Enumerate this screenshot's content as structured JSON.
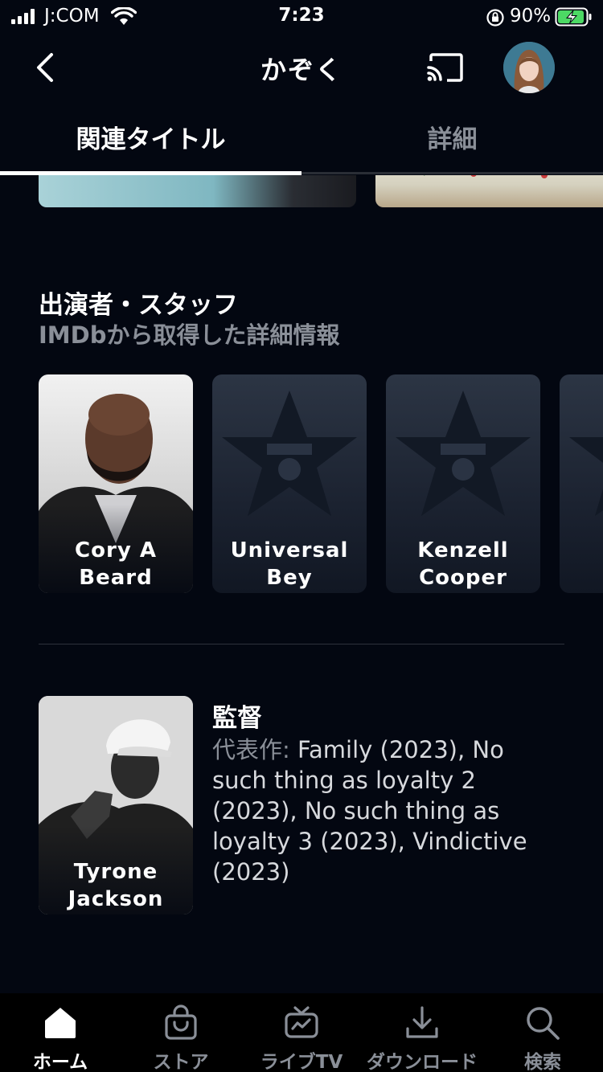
{
  "status_bar": {
    "carrier": "J:COM",
    "time": "7:23",
    "battery_percent": "90%"
  },
  "header": {
    "title": "かぞく"
  },
  "tabs": [
    {
      "label": "関連タイトル",
      "active": true
    },
    {
      "label": "詳細",
      "active": false
    }
  ],
  "cast_section": {
    "title": "出演者・スタッフ",
    "subtitle": "IMDbから取得した詳細情報",
    "members": [
      {
        "name_line1": "Cory A",
        "name_line2": "Beard",
        "has_photo": true
      },
      {
        "name_line1": "Universal",
        "name_line2": "Bey",
        "has_photo": false
      },
      {
        "name_line1": "Kenzell",
        "name_line2": "Cooper",
        "has_photo": false
      }
    ]
  },
  "director": {
    "name_line1": "Tyrone",
    "name_line2": "Jackson",
    "role": "監督",
    "works_label": "代表作: ",
    "works": "Family (2023), No such thing as loyalty 2 (2023), No such thing as loyalty 3 (2023), Vindictive (2023)"
  },
  "bottom_nav": [
    {
      "label": "ホーム",
      "icon": "home-icon",
      "active": true
    },
    {
      "label": "ストア",
      "icon": "store-bag-icon",
      "active": false
    },
    {
      "label": "ライブTV",
      "icon": "live-tv-icon",
      "active": false
    },
    {
      "label": "ダウンロード",
      "icon": "download-icon",
      "active": false
    },
    {
      "label": "検索",
      "icon": "search-icon",
      "active": false
    }
  ],
  "colors": {
    "background": "#030711",
    "muted_text": "#8a8f98",
    "battery_charging": "#4cd964"
  }
}
